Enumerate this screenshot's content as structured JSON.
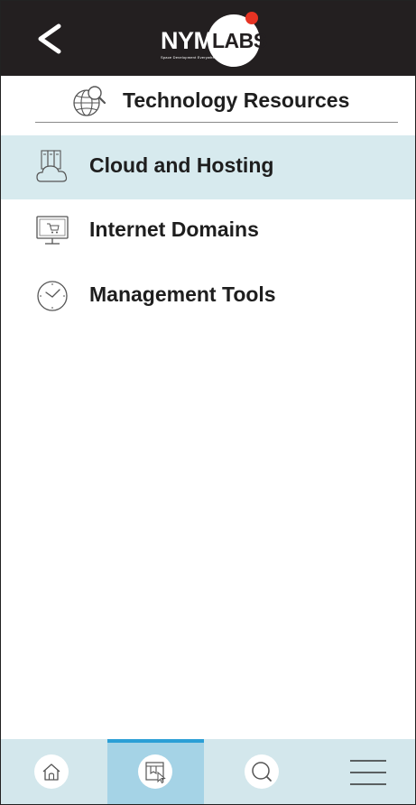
{
  "header": {
    "back_label": "<",
    "logo": {
      "part1": "NYM",
      "part2": "LABS",
      "tagline": "Space Development Everywhere"
    }
  },
  "section": {
    "title": "Technology Resources",
    "icon": "globe-search-icon"
  },
  "menu": {
    "items": [
      {
        "label": "Cloud and Hosting",
        "icon": "cloud-server-icon",
        "active": true
      },
      {
        "label": "Internet Domains",
        "icon": "monitor-cart-icon",
        "active": false
      },
      {
        "label": "Management Tools",
        "icon": "clock-icon",
        "active": false
      }
    ]
  },
  "tabbar": {
    "tabs": [
      {
        "icon": "home-icon",
        "active": false
      },
      {
        "icon": "bookmark-cursor-icon",
        "active": true
      },
      {
        "icon": "search-icon",
        "active": false
      },
      {
        "icon": "hamburger-menu-icon",
        "active": false
      }
    ]
  },
  "colors": {
    "header_bg": "#231f20",
    "active_row_bg": "#d7eaee",
    "tabbar_bg": "#d3e7ec",
    "active_tab_bg": "#a5d3e6",
    "active_tab_indicator": "#2a9fd6",
    "logo_dot": "#e63323"
  }
}
